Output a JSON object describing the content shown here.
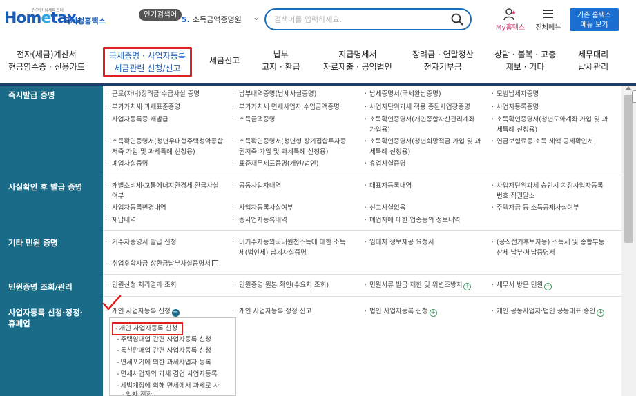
{
  "brand": {
    "tagline": "안전한 납세파트너",
    "logo_ho": "Hom",
    "logo_e": "e",
    "logo_tax": "tax.",
    "name_kr": "국세청홈택스"
  },
  "header": {
    "hot_badge": "인기검색어",
    "hot_number": "5.",
    "hot_term": "소득금액증명원",
    "search_placeholder": "검색어를 입력하세요.",
    "my_home": "My홈택스",
    "all_menu": "전체메뉴",
    "classic_line1": "기존 홈택스",
    "classic_line2": "메뉴 보기"
  },
  "gnb": [
    {
      "line1": "전자(세금)계산서",
      "line2": "현금영수증 · 신용카드"
    },
    {
      "line1": "국세증명 · 사업자등록",
      "line2": "세금관련 신청/신고"
    },
    {
      "line1": "세금신고",
      "line2": ""
    },
    {
      "line1": "납부",
      "line2": "고지 · 환급"
    },
    {
      "line1": "지급명세서",
      "line2": "자료제출 · 공익법인"
    },
    {
      "line1": "장려금 · 연말정산",
      "line2": "전자기부금"
    },
    {
      "line1": "상담 · 불복 · 고충",
      "line2": "제보 · 기타"
    },
    {
      "line1": "세무대리",
      "line2": "납세관리"
    }
  ],
  "categories": [
    "즉시발급 증명",
    "사실확인 후 발급 증명",
    "기타 민원 증명",
    "민원증명 조회/관리",
    "사업자등록 신청·정정·",
    "휴폐업"
  ],
  "items": {
    "r1": [
      "근로(자녀)장려금 수급사실 증명",
      "납부내역증명(납세사실증명)",
      "납세증명서(국세완납증명)",
      "모범납세자증명",
      "부가가치세 과세표준증명",
      "부가가치세 면세사업자 수입금액증명",
      "사업자단위과세 적용 종된사업장증명",
      "사업자등록증명",
      "사업자등록증 재발급",
      "소득금액증명",
      "소득확인증명서(개인종합자산관리계좌",
      "가입용)",
      "소득확인증명서(청년도약계좌 가입 및 과",
      "세특례 신청용)",
      "소득확인증명서(청년우대형주택청약종합",
      "저축 가입 및 과세특례 신청용)",
      "소득확인증명서(청년형 장기집합투자증",
      "권저축 가입 및 과세특례 신청용)",
      "소득확인증명서(청년희망적금 가입 및 과",
      "세특례 신청용)",
      "연금보험료등 소득·세액 공제확인서",
      "폐업사실증명",
      "표준재무제표증명(개인/법인)",
      "휴업사실증명"
    ],
    "r2": [
      "개별소비세·교통에너지환경세 환급사실",
      "여부",
      "공동사업자내역",
      "대표자등록내역",
      "사업자단위과세 승인시 지점사업자등록",
      "번호 직권말소",
      "사업자등록변경내역",
      "사업자등록사실여부",
      "신고사실없음",
      "주택자금 등 소득공제사실여부",
      "체납내역",
      "총사업자등록내역",
      "폐업자에 대한 업종등의 정보내역"
    ],
    "r3": [
      "거주자증명서 발급 신청",
      "비거주자등의국내원천소득에 대한 소득",
      "세(법인세) 납세사실증명",
      "임대차 정보제공 요청서",
      "(공직선거후보자용) 소득세 및 종합부동",
      "산세 납부·체납증명서",
      "취업후학자금 상환금납부사실증명서"
    ],
    "r4": [
      "민원신청 처리결과 조회",
      "민원증명 원본 확인(수요처 조회)",
      "민원서류 발급 제한 및 위변조방지",
      "세무서 방문 민원"
    ],
    "r5": [
      "개인 사업자등록 신청",
      "개인 사업자등록 정정 신고",
      "법인 사업자등록 신청",
      "개인 공동사업자·법인 공동대표 승인"
    ]
  },
  "submenu": [
    "개인 사업자등록 신청",
    "주택임대업 간편 사업자등록 신청",
    "통신판매업 간편 사업자등록 신청",
    "면세포기에 의한 과세사업자 등록",
    "면세사업자의 과세 겸업 사업자등록",
    "세법개정에 의해 면세에서 과세로 사",
    "업자 전환"
  ],
  "colors": {
    "brand_blue": "#1b5cb5",
    "left_column": "#1a6b87",
    "highlight_red": "#e02020",
    "classic_button": "#1b6fd1"
  }
}
